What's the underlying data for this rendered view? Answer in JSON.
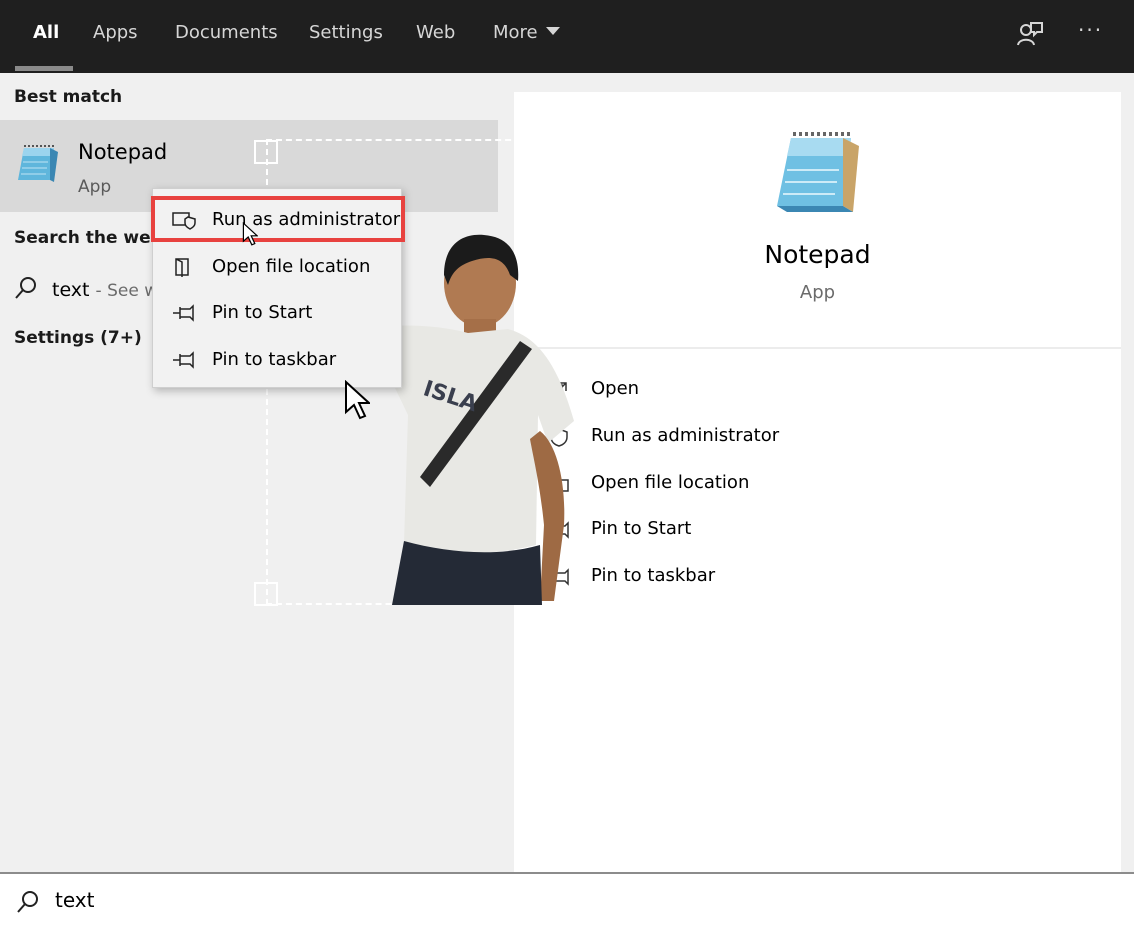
{
  "topbar": {
    "tabs": [
      {
        "label": "All",
        "active": true
      },
      {
        "label": "Apps"
      },
      {
        "label": "Documents"
      },
      {
        "label": "Settings"
      },
      {
        "label": "Web"
      },
      {
        "label": "More"
      }
    ],
    "feedback_icon": "feedback-person-icon",
    "more_options_label": "···"
  },
  "left_panel": {
    "best_match_heading": "Best match",
    "best_match": {
      "title": "Notepad",
      "subtitle": "App",
      "icon": "notepad-icon"
    },
    "search_web_heading": "Search the web",
    "web_result": {
      "query": "text",
      "suffix": "- See w"
    },
    "settings_heading": "Settings (7+)"
  },
  "context_menu": {
    "items": [
      {
        "label": "Run as administrator",
        "icon": "shield-icon",
        "highlighted": true
      },
      {
        "label": "Open file location",
        "icon": "folder-icon"
      },
      {
        "label": "Pin to Start",
        "icon": "pin-icon"
      },
      {
        "label": "Pin to taskbar",
        "icon": "pin-icon"
      }
    ],
    "highlight_color": "#e8423f"
  },
  "right_panel": {
    "title": "Notepad",
    "subtitle": "App",
    "actions": [
      {
        "label": "Open",
        "icon": "open-icon"
      },
      {
        "label": "Run as administrator",
        "icon": "shield-icon"
      },
      {
        "label": "Open file location",
        "icon": "folder-icon"
      },
      {
        "label": "Pin to Start",
        "icon": "pin-icon"
      },
      {
        "label": "Pin to taskbar",
        "icon": "pin-icon"
      }
    ]
  },
  "search_box": {
    "value": "text",
    "icon": "search-icon"
  },
  "colors": {
    "topbar": "#1f1f1f",
    "selected_row": "#d9d9d9",
    "panel": "#f0f0f0"
  }
}
